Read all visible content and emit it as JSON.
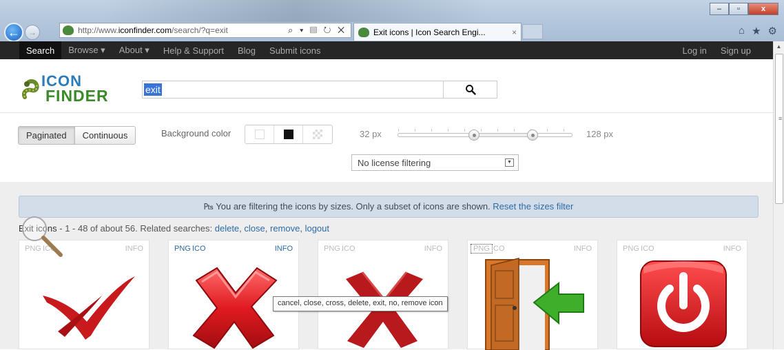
{
  "browser": {
    "url_plain_start": "http://www.",
    "url_domain": "iconfinder.com",
    "url_rest": "/search/?q=exit",
    "addr_controls": "⌕ ▾ ▤ ↻ ✕",
    "tab_title": "Exit icons | Icon Search Engi...",
    "tab_close": "×",
    "window_buttons": {
      "minimize": "–",
      "maximize": "▫",
      "close": "x"
    },
    "tools": {
      "home": "⌂",
      "favorites": "★",
      "settings": "⚙"
    }
  },
  "sitenav": {
    "search": "Search",
    "browse": "Browse ▾",
    "about": "About ▾",
    "help": "Help & Support",
    "blog": "Blog",
    "submit": "Submit icons",
    "login": "Log in",
    "signup": "Sign up"
  },
  "header": {
    "logo_line1": "ICON",
    "logo_line2": "FINDER",
    "query": "exit",
    "search_button_icon": "magnifier-icon"
  },
  "controls": {
    "paginated": "Paginated",
    "continuous": "Continuous",
    "background_label": "Background color",
    "size_min": "32 px",
    "size_max": "128 px",
    "size_range": {
      "min": 32,
      "max": 128
    },
    "license_select": "No license filtering"
  },
  "alert": {
    "icon": "▼̅",
    "text": "You are filtering the icons by sizes. Only a subset of icons are shown.",
    "link": "Reset the sizes filter"
  },
  "summary": {
    "lead": "Exit icons",
    "range": " - 1 - 48 of about 56.",
    "related_label": " Related searches: ",
    "related": [
      "delete",
      "close",
      "remove",
      "logout"
    ],
    "sep": ", "
  },
  "cards": [
    {
      "png": "PNG",
      "ico": "ICO",
      "info": "INFO",
      "icon": "red-check-cross-icon"
    },
    {
      "png": "PNG",
      "ico": "ICO",
      "info": "INFO",
      "icon": "red-3d-cross-icon"
    },
    {
      "png": "PNG",
      "ico": "ICO",
      "info": "INFO",
      "icon": "dark-red-cross-icon"
    },
    {
      "png": "PNG",
      "ico": "ICO",
      "info": "INFO",
      "icon": "door-exit-arrow-icon"
    },
    {
      "png": "PNG",
      "ico": "ICO",
      "info": "INFO",
      "icon": "red-power-button-icon"
    }
  ],
  "tooltip": "cancel, close, cross, delete, exit, no, remove icon",
  "colors": {
    "nav_bg": "#262626",
    "link": "#2e6aa6",
    "alert_bg": "#d3dde9",
    "content_bg": "#eeeeee",
    "icon_red": "#d8141a"
  }
}
